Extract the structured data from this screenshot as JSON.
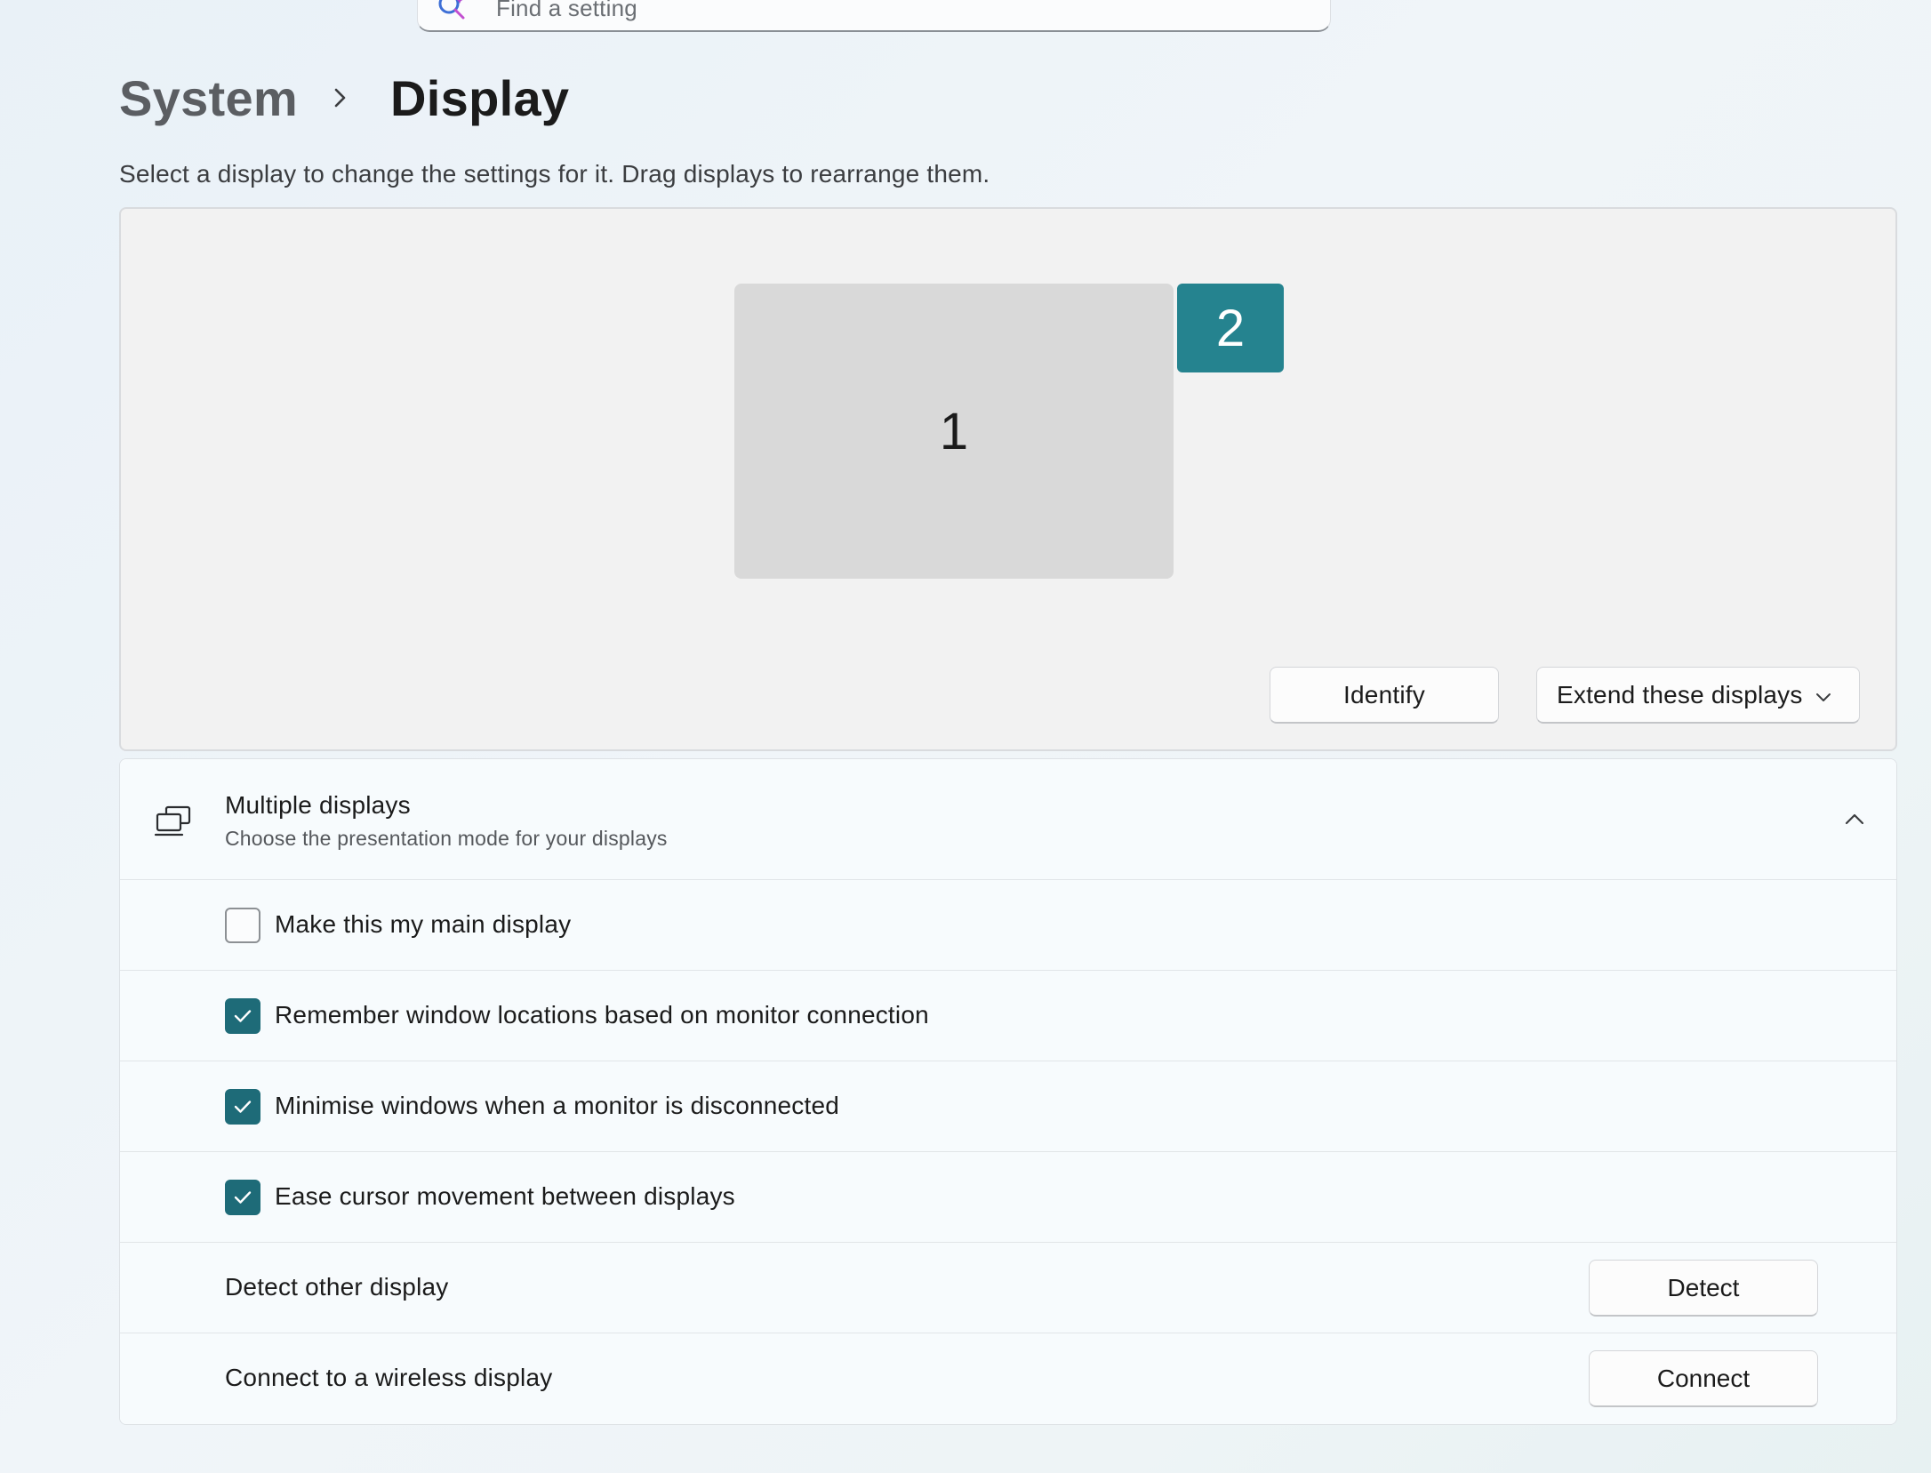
{
  "search": {
    "placeholder": "Find a setting",
    "icon": "search-icon"
  },
  "breadcrumb": {
    "parent": "System",
    "separator_icon": "chevron-right-icon",
    "current": "Display"
  },
  "subtitle": "Select a display to change the settings for it. Drag displays to rearrange them.",
  "arrangement": {
    "monitors": [
      {
        "label": "1",
        "selected": false
      },
      {
        "label": "2",
        "selected": true
      }
    ],
    "identify_label": "Identify",
    "mode_selected": "Extend these displays"
  },
  "colors": {
    "accent": "#1e6b78",
    "selected_monitor": "#25838f",
    "monitor": "#d9d9d9"
  },
  "multiple_displays": {
    "title": "Multiple displays",
    "description": "Choose the presentation mode for your displays",
    "icon": "multiple-displays-icon",
    "expanded": true,
    "options": [
      {
        "label": "Make this my main display",
        "checked": false
      },
      {
        "label": "Remember window locations based on monitor connection",
        "checked": true
      },
      {
        "label": "Minimise windows when a monitor is disconnected",
        "checked": true
      },
      {
        "label": "Ease cursor movement between displays",
        "checked": true
      }
    ],
    "detect": {
      "label": "Detect other display",
      "button": "Detect"
    },
    "connect": {
      "label": "Connect to a wireless display",
      "button": "Connect"
    }
  }
}
